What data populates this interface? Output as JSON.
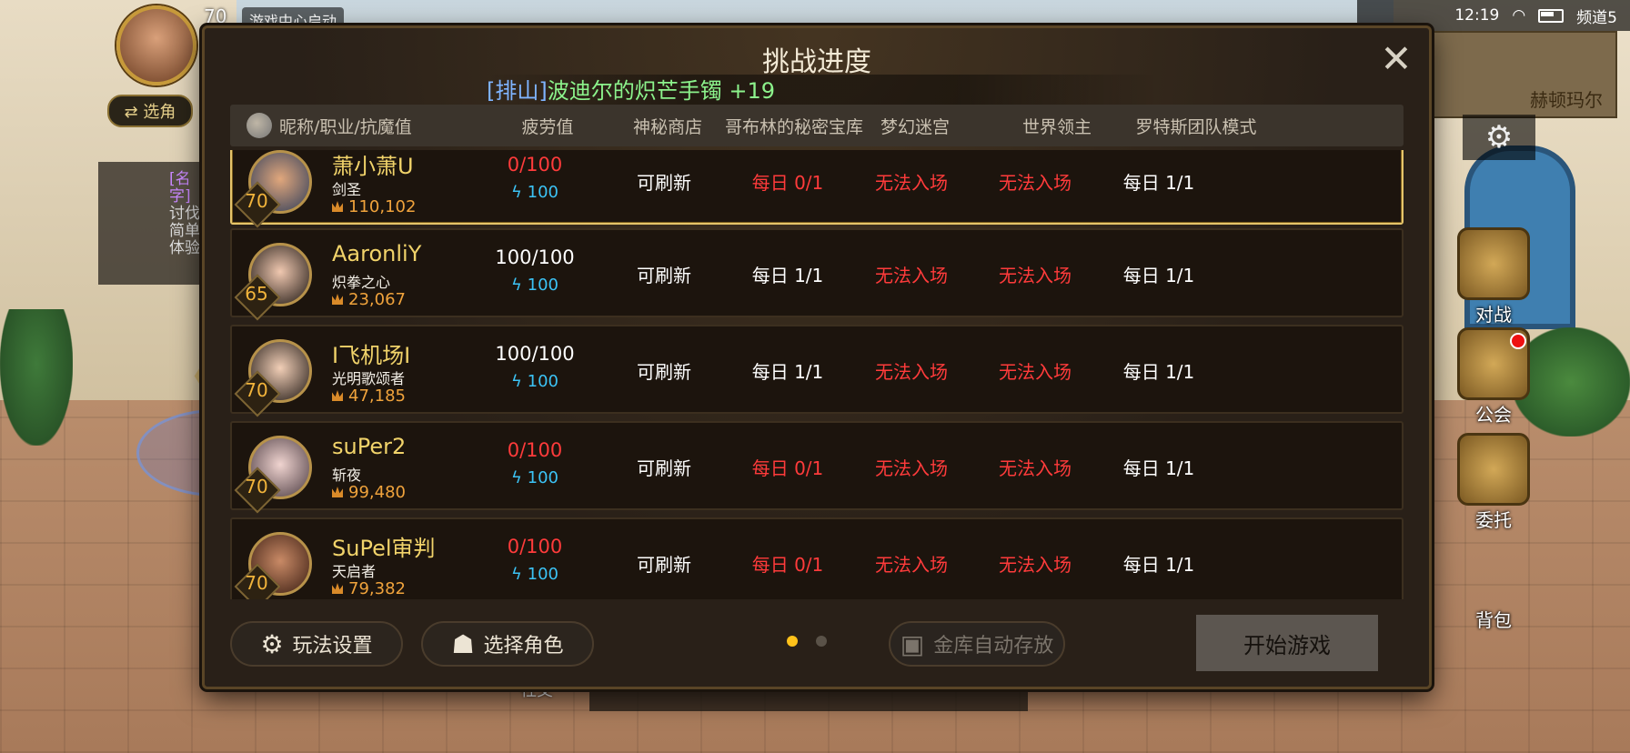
{
  "hud": {
    "level": "70",
    "center_text": "游戏中心启动",
    "switch_label": "⇄ 选角",
    "quest": {
      "name": "[名字]",
      "line1": "讨伐",
      "line2": "简单",
      "line3": "体验"
    },
    "status": {
      "time": "12:19",
      "channel": "频道5"
    },
    "minimap_name": "赫顿玛尔",
    "side_buttons": [
      {
        "label": "对战"
      },
      {
        "label": "公会"
      },
      {
        "label": "委托"
      },
      {
        "label": "背包"
      }
    ],
    "bottom_labels": [
      "社交"
    ]
  },
  "dialog": {
    "title": "挑战进度",
    "notice_tag": "[排山]",
    "notice_item": "波迪尔的炽芒手镯 +19",
    "headers": {
      "name": "昵称/职业/抗魔值",
      "fatigue": "疲劳值",
      "shop": "神秘商店",
      "goblin": "哥布林的秘密宝库",
      "dream": "梦幻迷宫",
      "boss": "世界领主",
      "rotes": "罗特斯团队模式"
    },
    "rows": [
      {
        "name": "萧小萧U",
        "job": "剑圣",
        "level": "70",
        "power": "110,102",
        "fatigue": "0/100",
        "energy": "100",
        "shop": "可刷新",
        "goblin": "每日 0/1",
        "dream": "无法入场",
        "boss": "无法入场",
        "rotes": "每日 1/1"
      },
      {
        "name": "AaronliY",
        "job": "炽拳之心",
        "level": "65",
        "power": "23,067",
        "fatigue": "100/100",
        "energy": "100",
        "shop": "可刷新",
        "goblin": "每日 1/1",
        "dream": "无法入场",
        "boss": "无法入场",
        "rotes": "每日 1/1"
      },
      {
        "name": "I飞机场I",
        "job": "光明歌颂者",
        "level": "70",
        "power": "47,185",
        "fatigue": "100/100",
        "energy": "100",
        "shop": "可刷新",
        "goblin": "每日 1/1",
        "dream": "无法入场",
        "boss": "无法入场",
        "rotes": "每日 1/1"
      },
      {
        "name": "suPer2",
        "job": "斩夜",
        "level": "70",
        "power": "99,480",
        "fatigue": "0/100",
        "energy": "100",
        "shop": "可刷新",
        "goblin": "每日 0/1",
        "dream": "无法入场",
        "boss": "无法入场",
        "rotes": "每日 1/1"
      },
      {
        "name": "SuPel审判",
        "job": "天启者",
        "level": "70",
        "power": "79,382",
        "fatigue": "0/100",
        "energy": "100",
        "shop": "可刷新",
        "goblin": "每日 0/1",
        "dream": "无法入场",
        "boss": "无法入场",
        "rotes": "每日 1/1"
      }
    ],
    "buttons": {
      "settings": "玩法设置",
      "select_char": "选择角色",
      "auto_store": "金库自动存放",
      "start": "开始游戏"
    }
  },
  "colors": {
    "red": "#ff3b3b",
    "gold": "#f1d36a",
    "energy": "#3cc3f5",
    "accent": "#ffc21a"
  }
}
